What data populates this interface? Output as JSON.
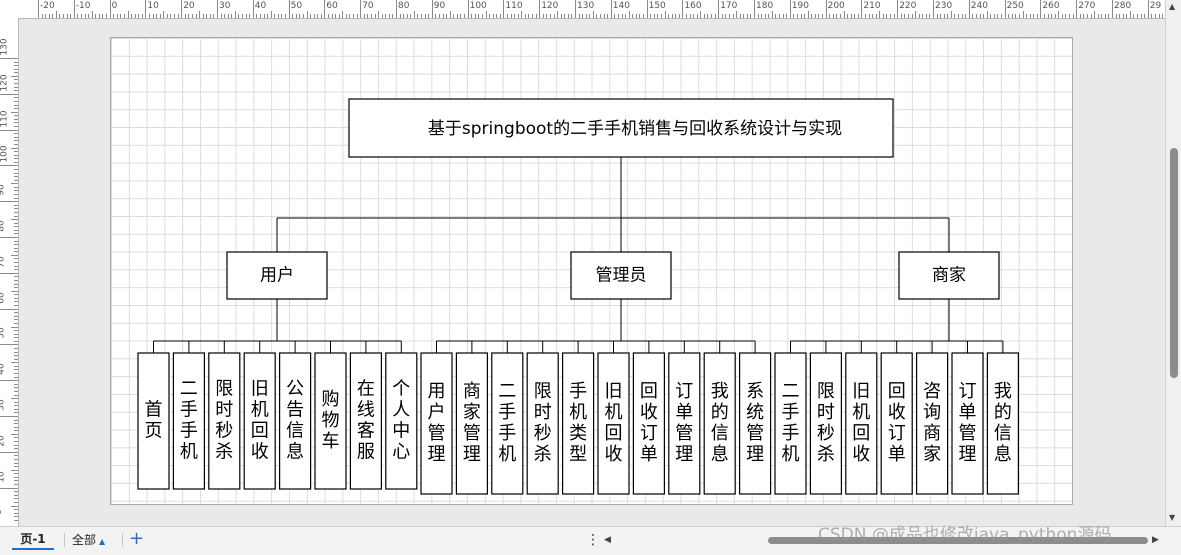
{
  "ruler": {
    "top_labels": [
      "-20",
      "-10",
      "0",
      "10",
      "20",
      "30",
      "40",
      "50",
      "60",
      "70",
      "80",
      "90",
      "100",
      "110",
      "120",
      "130",
      "140",
      "150",
      "160",
      "170",
      "180",
      "190",
      "200",
      "210",
      "220",
      "230",
      "240",
      "250",
      "260",
      "270",
      "280",
      "29"
    ],
    "left_labels": [
      "130",
      "120",
      "110",
      "100",
      "90",
      "80",
      "70",
      "60",
      "50",
      "40",
      "30",
      "20",
      "10",
      "0"
    ]
  },
  "diagram": {
    "root": "基于springboot的二手手机销售与回收系统设计与实现",
    "roles": [
      {
        "label": "用户",
        "children": [
          "首页",
          "二手手机",
          "限时秒杀",
          "旧机回收",
          "公告信息",
          "购物车",
          "在线客服",
          "个人中心"
        ]
      },
      {
        "label": "管理员",
        "children": [
          "用户管理",
          "商家管理",
          "二手手机",
          "限时秒杀",
          "手机类型",
          "旧机回收",
          "回收订单",
          "订单管理",
          "我的信息",
          "系统管理"
        ]
      },
      {
        "label": "商家",
        "children": [
          "二手手机",
          "限时秒杀",
          "旧机回收",
          "回收订单",
          "咨询商家",
          "订单管理",
          "我的信息"
        ]
      }
    ]
  },
  "bottom_bar": {
    "page_tab": "页-1",
    "all_pages": "全部",
    "add_icon": "plus-icon",
    "more_icon": "vertical-dots-icon"
  },
  "watermark": "CSDN @成品也修改java_python源码",
  "colors": {
    "accent": "#1f6fd1",
    "grid": "#dcdcdc",
    "border": "#000000"
  }
}
